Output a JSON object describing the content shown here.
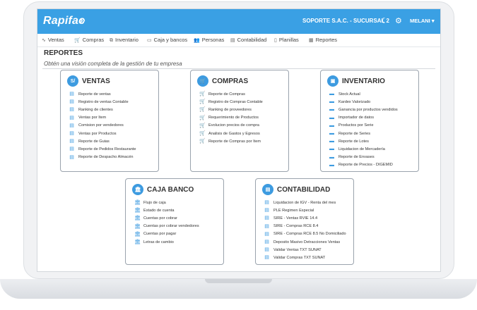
{
  "app": {
    "brand": "Rapifac",
    "company": "SOPORTE S.A.C. - SUCURSAL 2",
    "user": "MELANI ▾"
  },
  "nav": [
    {
      "label": "Ventas",
      "icon": "chart-line-icon"
    },
    {
      "label": "Compras",
      "icon": "cart-icon"
    },
    {
      "label": "Inventario",
      "icon": "boxes-icon"
    },
    {
      "label": "Caja y bancos",
      "icon": "cash-icon"
    },
    {
      "label": "Personas",
      "icon": "people-icon"
    },
    {
      "label": "Contabilidad",
      "icon": "ledger-icon"
    },
    {
      "label": "Planillas",
      "icon": "document-icon"
    },
    {
      "label": "Reportes",
      "icon": "report-icon"
    }
  ],
  "page": {
    "title": "REPORTES",
    "subtitle": "Obtén una visión completa de la gestión de tu empresa"
  },
  "cards": [
    {
      "id": "ventas",
      "title": "VENTAS",
      "icon_text": "S/",
      "icon": "currency-icon",
      "items": [
        "Reporte de ventas",
        "Registro de ventas Contable",
        "Ranking de clientes",
        "Ventas por Item",
        "Comision por vendedores",
        "Ventas por Productos",
        "Reporte de Guias",
        "Reporte de Pedidos Restaurante",
        "Reporte de Despacho Almacén"
      ]
    },
    {
      "id": "compras",
      "title": "COMPRAS",
      "icon_text": "🛒",
      "icon": "cart-icon",
      "items": [
        "Reporte de Compras",
        "Registro de Compras Contable",
        "Ranking de proveedores",
        "Requerimiento de Productos",
        "Evolucion precios de compra",
        "Analisis de Gastos y Egresos",
        "Reporte de Compras por Item"
      ]
    },
    {
      "id": "inventario",
      "title": "INVENTARIO",
      "icon_text": "▣",
      "icon": "box-icon",
      "items": [
        "Stock Actual",
        "Kardex Valorizado",
        "Ganancia por productos vendidos",
        "Importador de datos",
        "Productos por Serie",
        "Reporte de Series",
        "Reporte de Lotes",
        "Liquidacion de Mercadería",
        "Reporte de Envases",
        "Reporte de Precios - DIGEMID"
      ]
    },
    {
      "id": "caja",
      "title": "CAJA BANCO",
      "icon_text": "🏛",
      "icon": "bank-icon",
      "items": [
        "Flujo de caja",
        "Estado de cuenta",
        "Cuentas por cobrar",
        "Cuentas por cobrar vendedores",
        "Cuentas por pagar",
        "Letras de cambio"
      ]
    },
    {
      "id": "contabilidad",
      "title": "CONTABILIDAD",
      "icon_text": "▤",
      "icon": "calculator-icon",
      "items": [
        "Liquidacion de IGV - Renta del mes",
        "PLE Regimen Especial",
        "SIRE - Ventas RVIE 14.4",
        "SIRE - Compras RCE 8.4",
        "SIRE - Compras RCE 8.5 No Domiciliado",
        "Deposito Masivo Detracciones Ventas",
        "Validar Ventas TXT SUNAT",
        "Validar Compras TXT SUNAT"
      ]
    }
  ]
}
